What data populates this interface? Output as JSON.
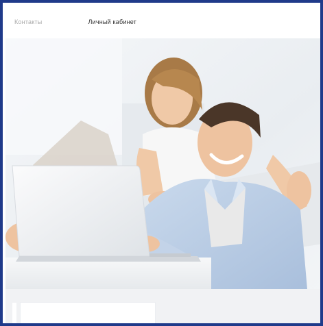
{
  "nav": {
    "contacts_label": "Контакты",
    "account_label": "Личный кабинет"
  },
  "hero": {
    "image_icon": "hero-photo-couple-laptop"
  },
  "colors": {
    "frame_border": "#1f3a8a",
    "hero_background": "#eef1f4",
    "bottom_background": "#f1f2f4"
  }
}
